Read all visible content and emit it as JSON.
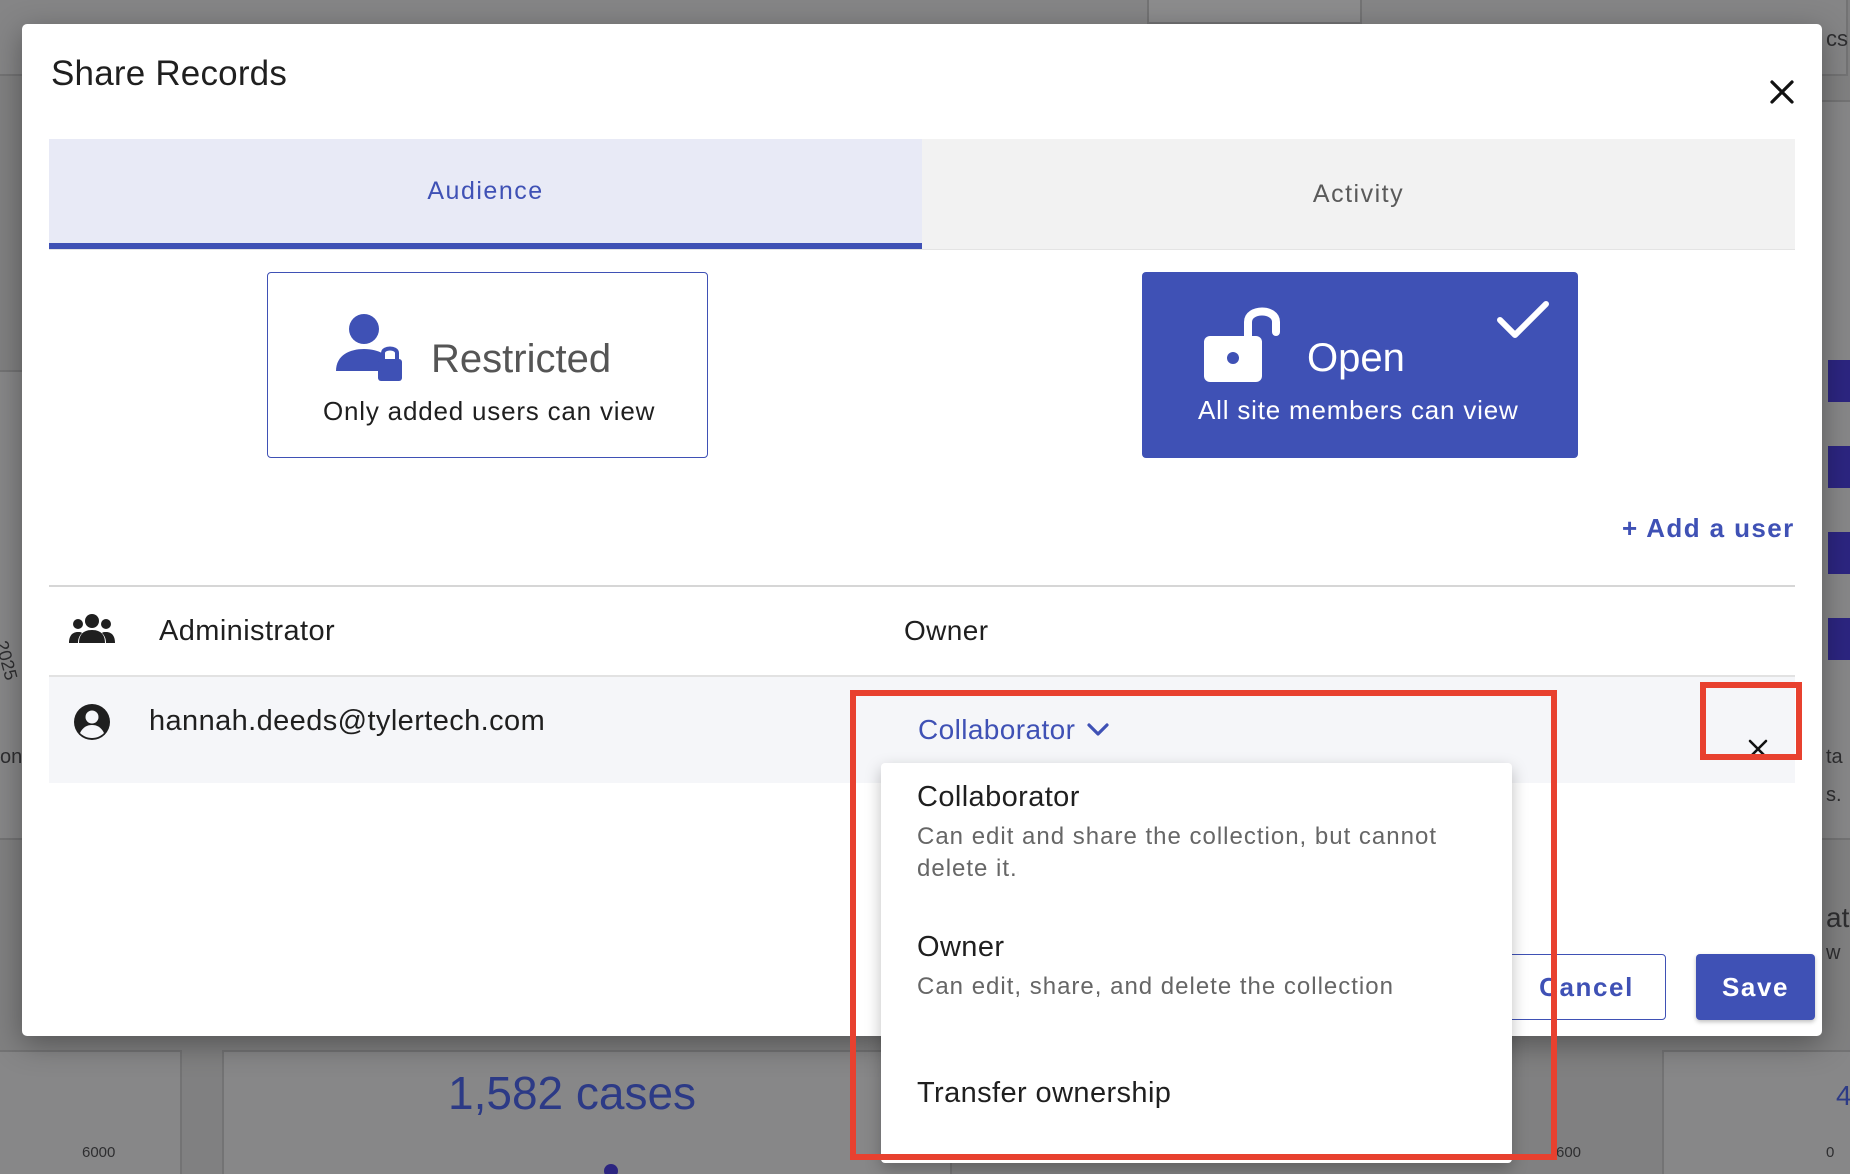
{
  "background": {
    "big_count": "1,582 cases",
    "axis_labels": [
      "6000",
      "600",
      "0"
    ],
    "rotated_year": "2025",
    "edge_fragments": [
      "cs",
      "ta",
      "s.",
      "at",
      "w",
      "ond",
      "4"
    ]
  },
  "dialog": {
    "title": "Share Records",
    "close_icon": "close-icon"
  },
  "tabs": [
    {
      "label": "Audience",
      "active": true
    },
    {
      "label": "Activity",
      "active": false
    }
  ],
  "access": {
    "restricted": {
      "title": "Restricted",
      "subtitle": "Only added users can view",
      "icon": "person-lock-icon",
      "selected": false
    },
    "open": {
      "title": "Open",
      "subtitle": "All site members can view",
      "icon": "unlocked-padlock-icon",
      "selected": true
    }
  },
  "add_user_label": "+ Add a user",
  "users": [
    {
      "name": "Administrator",
      "role": "Owner",
      "icon": "group-icon"
    },
    {
      "name": "hannah.deeds@tylertech.com",
      "role": "Collaborator",
      "icon": "account-circle-icon"
    }
  ],
  "role_menu": [
    {
      "label": "Collaborator",
      "description": "Can edit and share the collection, but cannot delete it."
    },
    {
      "label": "Owner",
      "description": "Can edit, share, and delete the collection"
    },
    {
      "label": "Transfer ownership",
      "description": ""
    }
  ],
  "buttons": {
    "cancel": "Cancel",
    "save": "Save"
  },
  "colors": {
    "primary": "#3f51b5",
    "tab_active_bg": "#e8eaf6",
    "highlight": "#e8412f"
  }
}
